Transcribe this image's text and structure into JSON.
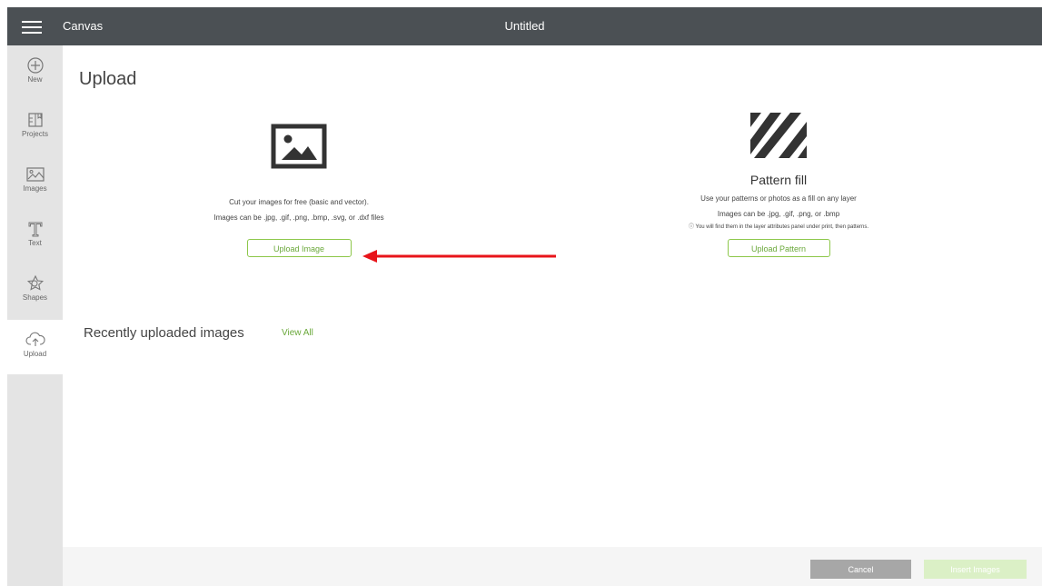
{
  "header": {
    "app_title": "Canvas",
    "document_title": "Untitled"
  },
  "sidebar": {
    "items": [
      {
        "label": "New",
        "icon": "plus-circle-icon"
      },
      {
        "label": "Projects",
        "icon": "projects-icon"
      },
      {
        "label": "Images",
        "icon": "images-icon"
      },
      {
        "label": "Text",
        "icon": "text-icon"
      },
      {
        "label": "Shapes",
        "icon": "shapes-icon"
      },
      {
        "label": "Upload",
        "icon": "upload-cloud-icon",
        "active": true
      }
    ]
  },
  "main": {
    "title": "Upload",
    "upload_image": {
      "line1": "Cut your images for free (basic and vector).",
      "line2": "Images can be .jpg, .gif, .png, .bmp, .svg, or .dxf files",
      "button": "Upload Image"
    },
    "pattern_fill": {
      "heading": "Pattern fill",
      "line1": "Use your patterns or photos as a fill on any layer",
      "line2": "Images can be .jpg, .gif, .png, or .bmp",
      "note": "ⓘ You will find them in the layer attributes panel under print, then patterns.",
      "button": "Upload Pattern"
    },
    "recent": {
      "title": "Recently uploaded images",
      "view_all": "View All"
    }
  },
  "footer": {
    "cancel": "Cancel",
    "insert": "Insert Images"
  },
  "colors": {
    "accent": "#8dc74a",
    "topbar": "#4b5054",
    "annotation_arrow": "#e8141a"
  }
}
